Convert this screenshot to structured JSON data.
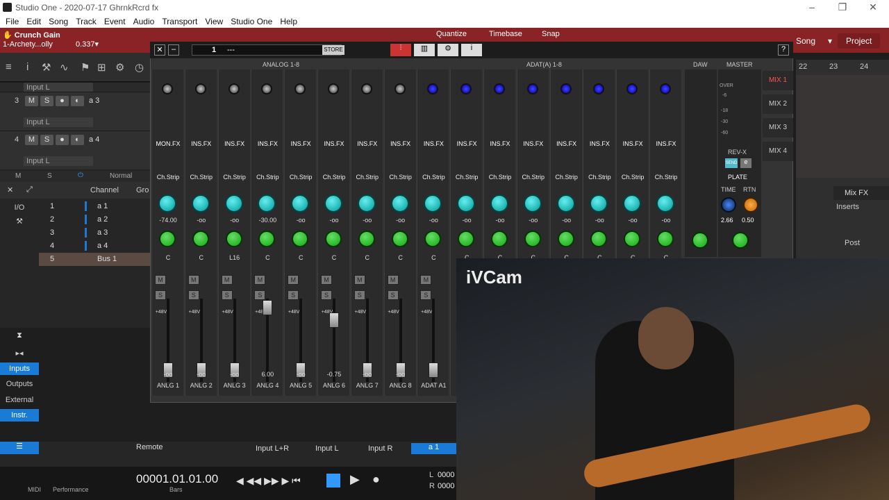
{
  "window": {
    "title": "Studio One - 2020-07-17 GhrnkRcrd fx"
  },
  "menu": [
    "File",
    "Edit",
    "Song",
    "Track",
    "Event",
    "Audio",
    "Transport",
    "View",
    "Studio One",
    "Help"
  ],
  "toolbar": {
    "device": "Crunch Gain",
    "preset": "1-Archety...olly",
    "value": "0.337",
    "quantize": "Quantize",
    "timebase": "Timebase",
    "snap": "Snap",
    "song": "Song",
    "project": "Project"
  },
  "tracks": [
    {
      "num": "3",
      "name": "a 3",
      "input": "Input L"
    },
    {
      "num": "4",
      "name": "a 4",
      "input": "Input L"
    }
  ],
  "top_input": "Input L",
  "left_bottom": {
    "m": "M",
    "s": "S",
    "mode": "Normal"
  },
  "channel_list": {
    "header": "Channel",
    "grp": "Gro",
    "io": "I/O",
    "rows": [
      {
        "n": "1",
        "label": "a 1"
      },
      {
        "n": "2",
        "label": "a 2"
      },
      {
        "n": "3",
        "label": "a 3"
      },
      {
        "n": "4",
        "label": "a 4"
      },
      {
        "n": "5",
        "label": "Bus 1"
      }
    ]
  },
  "left_side": [
    "Inputs",
    "Outputs",
    "External",
    "Instr."
  ],
  "mixer": {
    "preset": "1",
    "preset_name": "---",
    "store": "STORE",
    "groups": [
      "ANALOG 1-8",
      "ADAT(A) 1-8",
      "DAW",
      "MASTER"
    ],
    "strips": [
      {
        "fx": "MON.FX",
        "rev": "-74.00",
        "pan": "C",
        "vol": "-oo",
        "name": "ANLG 1"
      },
      {
        "fx": "INS.FX",
        "rev": "-oo",
        "pan": "C",
        "vol": "-oo",
        "name": "ANLG 2"
      },
      {
        "fx": "INS.FX",
        "rev": "-oo",
        "pan": "L16",
        "vol": "-oo",
        "name": "ANLG 3"
      },
      {
        "fx": "INS.FX",
        "rev": "-30.00",
        "pan": "C",
        "vol": "6.00",
        "name": "ANLG 4"
      },
      {
        "fx": "INS.FX",
        "rev": "-oo",
        "pan": "C",
        "vol": "-oo",
        "name": "ANLG 5"
      },
      {
        "fx": "INS.FX",
        "rev": "-oo",
        "pan": "C",
        "vol": "-0.75",
        "name": "ANLG 6"
      },
      {
        "fx": "INS.FX",
        "rev": "-oo",
        "pan": "C",
        "vol": "-oo",
        "name": "ANLG 7"
      },
      {
        "fx": "INS.FX",
        "rev": "-oo",
        "pan": "C",
        "vol": "-oo",
        "name": "ANLG 8"
      },
      {
        "fx": "INS.FX",
        "rev": "-oo",
        "pan": "C",
        "vol": "",
        "name": "ADAT A1"
      },
      {
        "fx": "INS.FX",
        "rev": "-oo",
        "pan": "C",
        "vol": "",
        "name": "A"
      },
      {
        "fx": "INS.FX",
        "rev": "-oo",
        "pan": "C",
        "vol": "",
        "name": ""
      },
      {
        "fx": "INS.FX",
        "rev": "-oo",
        "pan": "C",
        "vol": "",
        "name": ""
      },
      {
        "fx": "INS.FX",
        "rev": "-oo",
        "pan": "C",
        "vol": "",
        "name": ""
      },
      {
        "fx": "INS.FX",
        "rev": "-oo",
        "pan": "C",
        "vol": "",
        "name": ""
      },
      {
        "fx": "INS.FX",
        "rev": "-oo",
        "pan": "C",
        "vol": "",
        "name": ""
      },
      {
        "fx": "INS.FX",
        "rev": "-oo",
        "pan": "C",
        "vol": "",
        "name": ""
      }
    ],
    "chstrip": "Ch.Strip",
    "plus48": "+48V",
    "master": {
      "rev": "REV-X",
      "send": "SEND",
      "type": "PLATE",
      "time_lbl": "TIME",
      "rtn_lbl": "RTN",
      "time": "2.66",
      "rtn": "0.50",
      "meter": [
        "OVER",
        "-6",
        "-18",
        "-30",
        "-60"
      ]
    },
    "mix_tabs": [
      "MIX 1",
      "MIX 2",
      "MIX 3",
      "MIX 4"
    ]
  },
  "timeline": [
    "22",
    "23",
    "24"
  ],
  "right_panel": {
    "mixfx": "Mix FX",
    "inserts": "Inserts",
    "post": "Post"
  },
  "bottom_tabs": [
    "Input L+R",
    "Input L",
    "Input R",
    "a 1"
  ],
  "remote": "Remote",
  "transport": {
    "midi": "MIDI",
    "perf": "Performance",
    "time": "00001.01.01.00",
    "unit": "Bars",
    "l": "L",
    "r": "R",
    "lval": "0000",
    "rval": "0000"
  },
  "webcam": {
    "watermark": "iVCam"
  }
}
